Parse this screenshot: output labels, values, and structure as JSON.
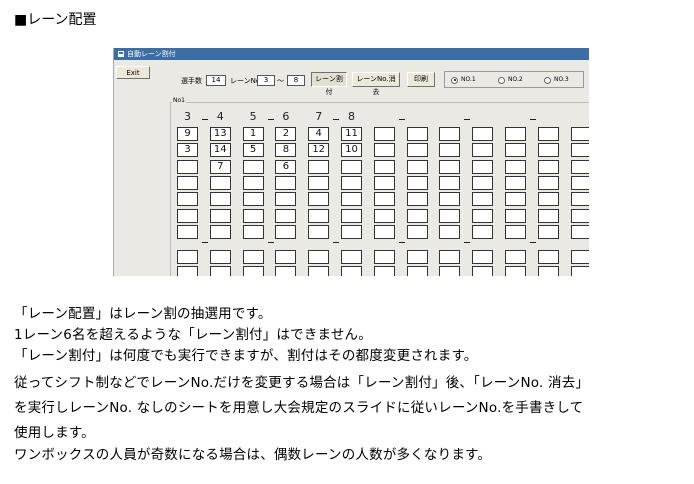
{
  "heading": "■レーン配置",
  "window": {
    "title": "自動レーン割付",
    "exit_label": "Exit",
    "entrants_label": "選手数",
    "entrants_value": "14",
    "lane_label": "レーンNo.",
    "lane_from": "3",
    "range_sep": "～",
    "lane_to": "8",
    "assign_button": "レーン割付",
    "clear_button": "レーンNo.消去",
    "print_button": "印刷",
    "radio_options": [
      "NO.1",
      "NO.2",
      "NO.3"
    ],
    "radio_selected": "NO.1",
    "group_label": "No1",
    "lanes": [
      {
        "header": "3",
        "values": [
          "9",
          "3",
          "",
          "",
          "",
          "",
          ""
        ]
      },
      {
        "header": "4",
        "values": [
          "13",
          "14",
          "7",
          "",
          "",
          "",
          ""
        ]
      },
      {
        "header": "5",
        "values": [
          "1",
          "5",
          "",
          "",
          "",
          "",
          ""
        ]
      },
      {
        "header": "6",
        "values": [
          "2",
          "8",
          "6",
          "",
          "",
          "",
          ""
        ]
      },
      {
        "header": "7",
        "values": [
          "4",
          "12",
          "",
          "",
          "",
          "",
          ""
        ]
      },
      {
        "header": "8",
        "values": [
          "11",
          "10",
          "",
          "",
          "",
          "",
          ""
        ]
      },
      {
        "header": "",
        "values": [
          "",
          "",
          "",
          "",
          "",
          "",
          ""
        ]
      },
      {
        "header": "",
        "values": [
          "",
          "",
          "",
          "",
          "",
          "",
          ""
        ]
      },
      {
        "header": "",
        "values": [
          "",
          "",
          "",
          "",
          "",
          "",
          ""
        ]
      },
      {
        "header": "",
        "values": [
          "",
          "",
          "",
          "",
          "",
          "",
          ""
        ]
      },
      {
        "header": "",
        "values": [
          "",
          "",
          "",
          "",
          "",
          "",
          ""
        ]
      },
      {
        "header": "",
        "values": [
          "",
          "",
          "",
          "",
          "",
          "",
          ""
        ]
      },
      {
        "header": "",
        "values": [
          "",
          "",
          "",
          "",
          "",
          "",
          ""
        ]
      }
    ]
  },
  "paragraphs": [
    "「レーン配置」はレーン割の抽選用です。",
    "1レーン6名を超えるような「レーン割付」はできません。",
    "「レーン割付」は何度でも実行できますが、割付はその都度変更されます。",
    "従ってシフト制などでレーンNo.だけを変更する場合は「レーン割付」後、「レーンNo. 消去」",
    "を実行しレーンNo. なしのシートを用意し大会規定のスライドに従いレーンNo.を手書きして",
    "使用します。",
    "ワンボックスの人員が奇数になる場合は、偶数レーンの人数が多くなります。"
  ]
}
